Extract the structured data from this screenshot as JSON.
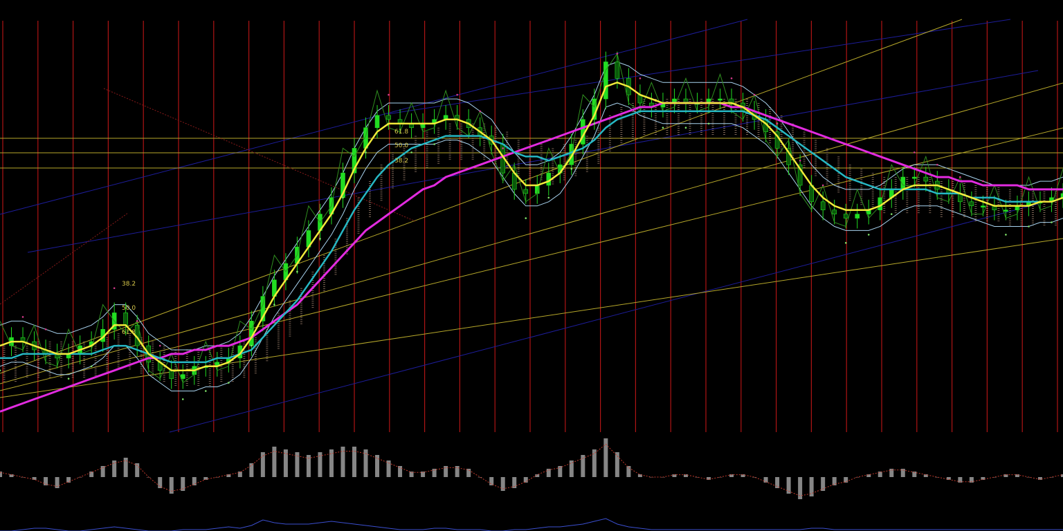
{
  "colors": {
    "background": "#000000",
    "period_separator": "#b01515",
    "candle": "#22dd22",
    "close_line": "#2f8f1f",
    "ma_fast": "#f2ea3a",
    "ma_mid": "#26b8c4",
    "ma_slow": "#e22be0",
    "bands": "#a9d4f0",
    "cloud": "#c9a48a",
    "psar": "#d73a8e",
    "trend_channel": "#1d1d9a",
    "fan_lines": "#b7a82a",
    "hist": "#9e9e9e",
    "signal": "#c0392b",
    "volume": "#3b4fd0"
  },
  "fib_labels": [
    "38.2",
    "50.0",
    "61.8",
    "61.8",
    "50.0",
    "38.2"
  ],
  "chart_data": {
    "type": "line",
    "grid": false,
    "ylim": [
      0,
      100
    ],
    "x": [
      0,
      1,
      2,
      3,
      4,
      5,
      6,
      7,
      8,
      9,
      10,
      11,
      12,
      13,
      14,
      15,
      16,
      17,
      18,
      19,
      20,
      21,
      22,
      23,
      24,
      25,
      26,
      27,
      28,
      29,
      30,
      31,
      32,
      33,
      34,
      35,
      36,
      37,
      38,
      39,
      40,
      41,
      42,
      43,
      44,
      45,
      46,
      47,
      48,
      49,
      50,
      51,
      52,
      53,
      54,
      55,
      56,
      57,
      58,
      59,
      60,
      61,
      62,
      63,
      64,
      65,
      66,
      67,
      68,
      69,
      70,
      71,
      72,
      73,
      74,
      75,
      76,
      77,
      78,
      79,
      80,
      81,
      82,
      83,
      84,
      85,
      86,
      87,
      88,
      89,
      90,
      91,
      92,
      93,
      94,
      95,
      96,
      97,
      98,
      99,
      100,
      101,
      102,
      103,
      104,
      105,
      106,
      107,
      108,
      109,
      110,
      111,
      112,
      113,
      114,
      115,
      116,
      117,
      118,
      119,
      120
    ],
    "close": [
      21,
      23,
      22,
      20,
      19,
      18,
      19,
      21,
      22,
      25,
      29,
      26,
      21,
      17,
      15,
      13,
      14,
      16,
      16,
      17,
      18,
      21,
      27,
      33,
      37,
      41,
      45,
      49,
      53,
      57,
      63,
      69,
      74,
      77,
      76,
      75,
      74,
      75,
      76,
      77,
      76,
      74,
      72,
      70,
      63,
      59,
      58,
      60,
      63,
      65,
      70,
      76,
      81,
      90,
      86,
      82,
      80,
      79,
      80,
      81,
      80,
      80,
      81,
      81,
      80,
      78,
      76,
      73,
      69,
      65,
      60,
      56,
      54,
      53,
      52,
      53,
      54,
      57,
      59,
      62,
      62,
      61,
      59,
      58,
      56,
      55,
      55,
      54,
      54,
      55,
      56,
      56,
      57,
      58
    ],
    "ma_fast": [
      21,
      22,
      22,
      21,
      20,
      19,
      19,
      20,
      21,
      23,
      26,
      26,
      23,
      19,
      17,
      15,
      15,
      15,
      16,
      16,
      17,
      19,
      23,
      28,
      33,
      37,
      41,
      45,
      49,
      53,
      58,
      64,
      69,
      73,
      75,
      75,
      75,
      75,
      75,
      76,
      76,
      75,
      73,
      71,
      67,
      63,
      60,
      60,
      61,
      63,
      67,
      72,
      77,
      84,
      85,
      84,
      82,
      81,
      80,
      80,
      80,
      80,
      80,
      80,
      80,
      79,
      77,
      75,
      72,
      68,
      64,
      60,
      57,
      55,
      54,
      54,
      54,
      55,
      57,
      59,
      60,
      60,
      60,
      59,
      58,
      57,
      56,
      55,
      55,
      55,
      55,
      56,
      56,
      57
    ],
    "ma_mid": [
      18,
      18,
      19,
      19,
      19,
      19,
      19,
      19,
      19,
      20,
      21,
      21,
      20,
      19,
      18,
      17,
      17,
      17,
      17,
      18,
      18,
      19,
      20,
      23,
      26,
      29,
      32,
      36,
      40,
      44,
      49,
      54,
      58,
      62,
      65,
      67,
      69,
      70,
      71,
      72,
      72,
      72,
      72,
      71,
      70,
      68,
      67,
      67,
      66,
      67,
      68,
      69,
      71,
      74,
      76,
      77,
      78,
      78,
      78,
      78,
      78,
      78,
      78,
      78,
      78,
      78,
      77,
      76,
      74,
      72,
      70,
      68,
      66,
      64,
      62,
      61,
      60,
      59,
      59,
      59,
      59,
      59,
      58,
      58,
      58,
      57,
      57,
      57,
      56,
      56,
      56,
      56,
      56,
      57
    ],
    "ma_slow": [
      5,
      6,
      7,
      8,
      9,
      10,
      11,
      12,
      13,
      14,
      15,
      16,
      17,
      18,
      18,
      19,
      19,
      20,
      20,
      21,
      21,
      22,
      23,
      25,
      27,
      29,
      31,
      34,
      37,
      40,
      43,
      46,
      49,
      51,
      53,
      55,
      57,
      59,
      60,
      62,
      63,
      64,
      65,
      66,
      67,
      68,
      69,
      70,
      71,
      72,
      73,
      74,
      75,
      76,
      77,
      78,
      79,
      79,
      80,
      80,
      80,
      80,
      80,
      80,
      79,
      79,
      78,
      77,
      76,
      75,
      74,
      73,
      72,
      71,
      70,
      69,
      68,
      67,
      66,
      65,
      64,
      63,
      62,
      62,
      61,
      61,
      60,
      60,
      60,
      60,
      59,
      59,
      59,
      59
    ],
    "hist": [
      2,
      1,
      0,
      -1,
      -3,
      -4,
      -2,
      0,
      2,
      4,
      6,
      7,
      5,
      0,
      -4,
      -6,
      -5,
      -3,
      -1,
      0,
      1,
      2,
      5,
      9,
      11,
      10,
      9,
      8,
      9,
      10,
      11,
      11,
      10,
      8,
      6,
      4,
      2,
      2,
      3,
      4,
      4,
      3,
      0,
      -3,
      -5,
      -4,
      -2,
      1,
      3,
      4,
      6,
      8,
      10,
      14,
      9,
      4,
      1,
      0,
      0,
      1,
      1,
      0,
      -1,
      0,
      1,
      1,
      0,
      -2,
      -4,
      -6,
      -8,
      -7,
      -5,
      -3,
      -2,
      0,
      1,
      2,
      3,
      3,
      2,
      1,
      0,
      -1,
      -2,
      -2,
      -1,
      0,
      1,
      1,
      0,
      -1,
      0,
      1
    ],
    "volume": [
      0,
      0,
      1,
      2,
      2,
      1,
      0,
      0,
      1,
      2,
      3,
      2,
      1,
      0,
      0,
      0,
      1,
      1,
      1,
      2,
      3,
      2,
      4,
      8,
      6,
      5,
      5,
      5,
      6,
      7,
      6,
      5,
      4,
      3,
      2,
      1,
      1,
      1,
      2,
      2,
      1,
      1,
      1,
      0,
      0,
      1,
      1,
      2,
      3,
      3,
      4,
      5,
      7,
      9,
      5,
      3,
      2,
      1,
      1,
      1,
      1,
      1,
      1,
      1,
      1,
      1,
      1,
      1,
      1,
      1,
      1,
      2,
      2,
      1,
      1,
      1,
      1,
      1,
      1,
      1,
      1,
      1,
      1,
      1,
      1,
      1,
      1,
      1,
      1,
      1,
      1,
      1,
      1,
      1
    ]
  }
}
